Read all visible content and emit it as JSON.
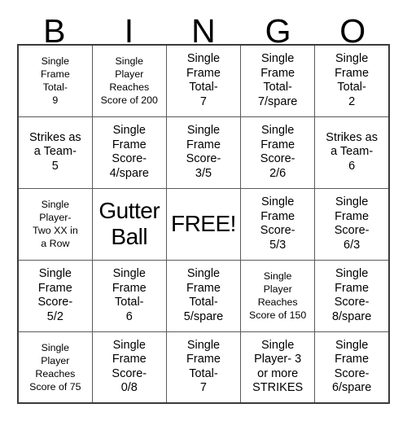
{
  "card": {
    "title_letters": [
      "B",
      "I",
      "N",
      "G",
      "O"
    ],
    "columns": 5,
    "rows": 5,
    "free_space_index": 12,
    "colors": {
      "background": "#ffffff",
      "text": "#000000",
      "grid_line": "#5a5a5a",
      "grid_border": "#3a3a3a"
    },
    "cells": [
      {
        "text": "Single\nFrame\nTotal-\n9",
        "size": "compact"
      },
      {
        "text": "Single\nPlayer\nReaches\nScore of 200",
        "size": "compact"
      },
      {
        "text": "Single\nFrame\nTotal-\n7",
        "size": "normal"
      },
      {
        "text": "Single\nFrame\nTotal-\n7/spare",
        "size": "normal"
      },
      {
        "text": "Single\nFrame\nTotal-\n2",
        "size": "normal"
      },
      {
        "text": "Strikes as\na Team-\n5",
        "size": "normal"
      },
      {
        "text": "Single\nFrame\nScore-\n4/spare",
        "size": "normal"
      },
      {
        "text": "Single\nFrame\nScore-\n3/5",
        "size": "normal"
      },
      {
        "text": "Single\nFrame\nScore-\n2/6",
        "size": "normal"
      },
      {
        "text": "Strikes as\na Team-\n6",
        "size": "normal"
      },
      {
        "text": "Single\nPlayer-\nTwo XX in\na Row",
        "size": "compact"
      },
      {
        "text": "Gutter\nBall",
        "size": "large"
      },
      {
        "text": "FREE!",
        "size": "large"
      },
      {
        "text": "Single\nFrame\nScore-\n5/3",
        "size": "normal"
      },
      {
        "text": "Single\nFrame\nScore-\n6/3",
        "size": "normal"
      },
      {
        "text": "Single\nFrame\nScore-\n5/2",
        "size": "normal"
      },
      {
        "text": "Single\nFrame\nTotal-\n6",
        "size": "normal"
      },
      {
        "text": "Single\nFrame\nTotal-\n5/spare",
        "size": "normal"
      },
      {
        "text": "Single\nPlayer\nReaches\nScore of 150",
        "size": "compact"
      },
      {
        "text": "Single\nFrame\nScore-\n8/spare",
        "size": "normal"
      },
      {
        "text": "Single\nPlayer\nReaches\nScore of 75",
        "size": "compact"
      },
      {
        "text": "Single\nFrame\nScore-\n0/8",
        "size": "normal"
      },
      {
        "text": "Single\nFrame\nTotal-\n7",
        "size": "normal"
      },
      {
        "text": "Single\nPlayer- 3\nor more\nSTRIKES",
        "size": "normal"
      },
      {
        "text": "Single\nFrame\nScore-\n6/spare",
        "size": "normal"
      }
    ]
  }
}
